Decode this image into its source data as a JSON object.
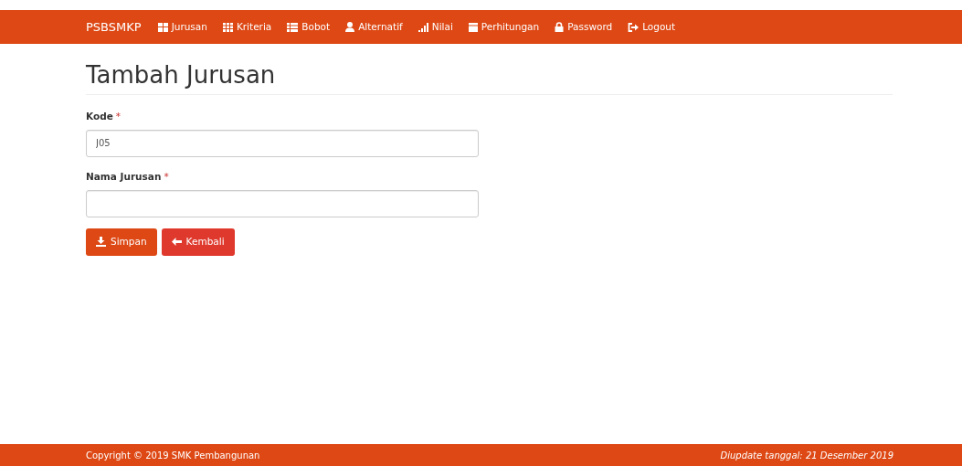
{
  "navbar": {
    "brand": "PSBSMKP",
    "items": [
      {
        "label": "Jurusan"
      },
      {
        "label": "Kriteria"
      },
      {
        "label": "Bobot"
      },
      {
        "label": "Alternatif"
      },
      {
        "label": "Nilai"
      },
      {
        "label": "Perhitungan"
      },
      {
        "label": "Password"
      },
      {
        "label": "Logout"
      }
    ]
  },
  "page": {
    "title": "Tambah Jurusan",
    "fields": [
      {
        "label": "Kode",
        "required_mark": "*",
        "value": "J05"
      },
      {
        "label": "Nama Jurusan",
        "required_mark": "*"
      }
    ],
    "buttons": [
      {
        "kind": "primary",
        "label": "Simpan"
      },
      {
        "kind": "danger",
        "label": "Kembali"
      }
    ]
  },
  "footer": {
    "copyright": "Copyright © 2019 SMK Pembangunan",
    "updated": "Diupdate tanggal: 21 Desember 2019"
  }
}
